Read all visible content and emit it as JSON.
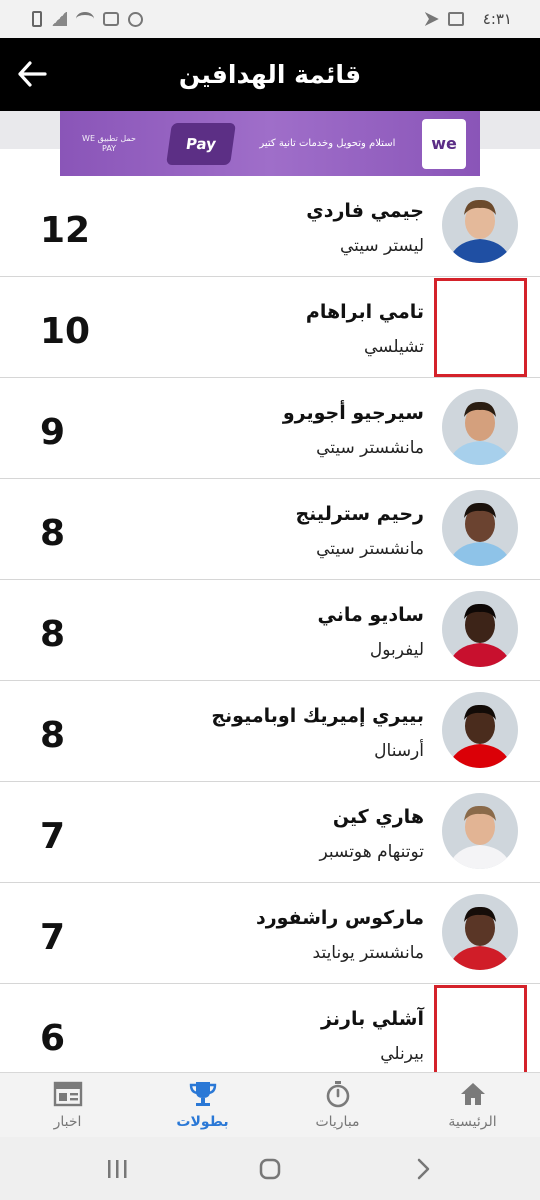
{
  "status_bar": {
    "time": "٤:٣١"
  },
  "header": {
    "title": "قائمة الهدافين"
  },
  "ad": {
    "brand": "we",
    "pay_label": "Pay",
    "headline": "استلام وتحويل وخدمات تانية كتير",
    "sub": "حمل تطبيق WE PAY"
  },
  "scorers": [
    {
      "name": "جيمي فاردي",
      "team": "ليستر سيتي",
      "goals": "12",
      "has_photo": true,
      "shirt": "#1f4fa3",
      "skin": "#e4b99a",
      "hair": "#6b4a2c"
    },
    {
      "name": "تامي ابراهام",
      "team": "تشيلسي",
      "goals": "10",
      "has_photo": false
    },
    {
      "name": "سيرجيو أجويرو",
      "team": "مانشستر سيتي",
      "goals": "9",
      "has_photo": true,
      "shirt": "#a7d0ec",
      "skin": "#d4a07d",
      "hair": "#2a1d12"
    },
    {
      "name": "رحيم سترلينج",
      "team": "مانشستر سيتي",
      "goals": "8",
      "has_photo": true,
      "shirt": "#8ec3e8",
      "skin": "#6b4330",
      "hair": "#1b120c"
    },
    {
      "name": "ساديو ماني",
      "team": "ليفربول",
      "goals": "8",
      "has_photo": true,
      "shirt": "#c8102e",
      "skin": "#3d2418",
      "hair": "#0e0806"
    },
    {
      "name": "بييري إميريك اوباميونج",
      "team": "أرسنال",
      "goals": "8",
      "has_photo": true,
      "shirt": "#db0007",
      "skin": "#4a2c1d",
      "hair": "#120b07"
    },
    {
      "name": "هاري كين",
      "team": "توتنهام هوتسبر",
      "goals": "7",
      "has_photo": true,
      "shirt": "#f4f4f6",
      "skin": "#e2b494",
      "hair": "#8a6a4a"
    },
    {
      "name": "ماركوس راشفورد",
      "team": "مانشستر يونايتد",
      "goals": "7",
      "has_photo": true,
      "shirt": "#d01d28",
      "skin": "#5a3626",
      "hair": "#150d09"
    },
    {
      "name": "آشلي بارنز",
      "team": "بيرنلي",
      "goals": "6",
      "has_photo": false
    }
  ],
  "bottom_nav": [
    {
      "label": "الرئيسية",
      "icon": "home-icon",
      "active": false
    },
    {
      "label": "مباريات",
      "icon": "stopwatch-icon",
      "active": false
    },
    {
      "label": "بطولات",
      "icon": "trophy-icon",
      "active": true
    },
    {
      "label": "اخبار",
      "icon": "news-icon",
      "active": false
    }
  ],
  "colors": {
    "header_bg": "#000000",
    "accent": "#2a78d6",
    "missing_photo_border": "#d4222a",
    "ad_purple": "#8a55b8"
  }
}
